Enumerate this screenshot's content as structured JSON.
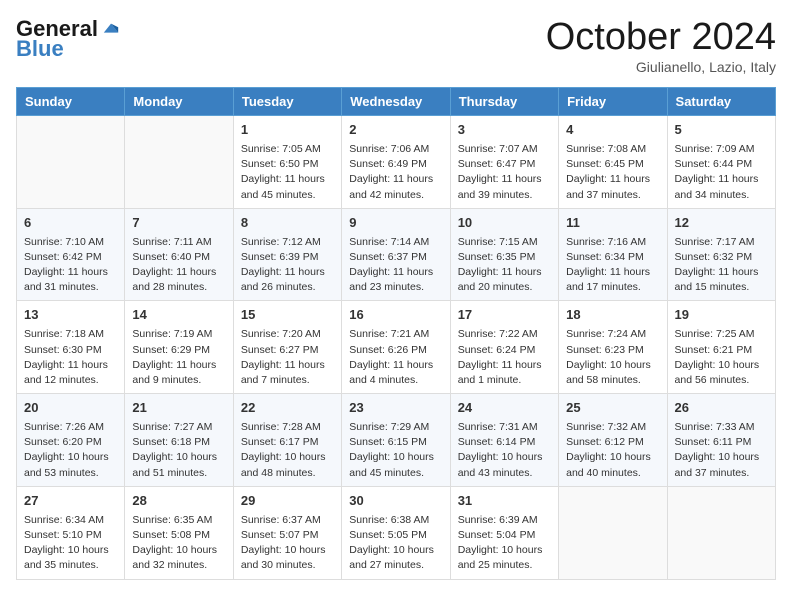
{
  "logo": {
    "general": "General",
    "blue": "Blue"
  },
  "title": {
    "month": "October 2024",
    "location": "Giulianello, Lazio, Italy"
  },
  "days": [
    "Sunday",
    "Monday",
    "Tuesday",
    "Wednesday",
    "Thursday",
    "Friday",
    "Saturday"
  ],
  "weeks": [
    [
      {
        "day": "",
        "sunrise": "",
        "sunset": "",
        "daylight": ""
      },
      {
        "day": "",
        "sunrise": "",
        "sunset": "",
        "daylight": ""
      },
      {
        "day": "1",
        "sunrise": "Sunrise: 7:05 AM",
        "sunset": "Sunset: 6:50 PM",
        "daylight": "Daylight: 11 hours and 45 minutes."
      },
      {
        "day": "2",
        "sunrise": "Sunrise: 7:06 AM",
        "sunset": "Sunset: 6:49 PM",
        "daylight": "Daylight: 11 hours and 42 minutes."
      },
      {
        "day": "3",
        "sunrise": "Sunrise: 7:07 AM",
        "sunset": "Sunset: 6:47 PM",
        "daylight": "Daylight: 11 hours and 39 minutes."
      },
      {
        "day": "4",
        "sunrise": "Sunrise: 7:08 AM",
        "sunset": "Sunset: 6:45 PM",
        "daylight": "Daylight: 11 hours and 37 minutes."
      },
      {
        "day": "5",
        "sunrise": "Sunrise: 7:09 AM",
        "sunset": "Sunset: 6:44 PM",
        "daylight": "Daylight: 11 hours and 34 minutes."
      }
    ],
    [
      {
        "day": "6",
        "sunrise": "Sunrise: 7:10 AM",
        "sunset": "Sunset: 6:42 PM",
        "daylight": "Daylight: 11 hours and 31 minutes."
      },
      {
        "day": "7",
        "sunrise": "Sunrise: 7:11 AM",
        "sunset": "Sunset: 6:40 PM",
        "daylight": "Daylight: 11 hours and 28 minutes."
      },
      {
        "day": "8",
        "sunrise": "Sunrise: 7:12 AM",
        "sunset": "Sunset: 6:39 PM",
        "daylight": "Daylight: 11 hours and 26 minutes."
      },
      {
        "day": "9",
        "sunrise": "Sunrise: 7:14 AM",
        "sunset": "Sunset: 6:37 PM",
        "daylight": "Daylight: 11 hours and 23 minutes."
      },
      {
        "day": "10",
        "sunrise": "Sunrise: 7:15 AM",
        "sunset": "Sunset: 6:35 PM",
        "daylight": "Daylight: 11 hours and 20 minutes."
      },
      {
        "day": "11",
        "sunrise": "Sunrise: 7:16 AM",
        "sunset": "Sunset: 6:34 PM",
        "daylight": "Daylight: 11 hours and 17 minutes."
      },
      {
        "day": "12",
        "sunrise": "Sunrise: 7:17 AM",
        "sunset": "Sunset: 6:32 PM",
        "daylight": "Daylight: 11 hours and 15 minutes."
      }
    ],
    [
      {
        "day": "13",
        "sunrise": "Sunrise: 7:18 AM",
        "sunset": "Sunset: 6:30 PM",
        "daylight": "Daylight: 11 hours and 12 minutes."
      },
      {
        "day": "14",
        "sunrise": "Sunrise: 7:19 AM",
        "sunset": "Sunset: 6:29 PM",
        "daylight": "Daylight: 11 hours and 9 minutes."
      },
      {
        "day": "15",
        "sunrise": "Sunrise: 7:20 AM",
        "sunset": "Sunset: 6:27 PM",
        "daylight": "Daylight: 11 hours and 7 minutes."
      },
      {
        "day": "16",
        "sunrise": "Sunrise: 7:21 AM",
        "sunset": "Sunset: 6:26 PM",
        "daylight": "Daylight: 11 hours and 4 minutes."
      },
      {
        "day": "17",
        "sunrise": "Sunrise: 7:22 AM",
        "sunset": "Sunset: 6:24 PM",
        "daylight": "Daylight: 11 hours and 1 minute."
      },
      {
        "day": "18",
        "sunrise": "Sunrise: 7:24 AM",
        "sunset": "Sunset: 6:23 PM",
        "daylight": "Daylight: 10 hours and 58 minutes."
      },
      {
        "day": "19",
        "sunrise": "Sunrise: 7:25 AM",
        "sunset": "Sunset: 6:21 PM",
        "daylight": "Daylight: 10 hours and 56 minutes."
      }
    ],
    [
      {
        "day": "20",
        "sunrise": "Sunrise: 7:26 AM",
        "sunset": "Sunset: 6:20 PM",
        "daylight": "Daylight: 10 hours and 53 minutes."
      },
      {
        "day": "21",
        "sunrise": "Sunrise: 7:27 AM",
        "sunset": "Sunset: 6:18 PM",
        "daylight": "Daylight: 10 hours and 51 minutes."
      },
      {
        "day": "22",
        "sunrise": "Sunrise: 7:28 AM",
        "sunset": "Sunset: 6:17 PM",
        "daylight": "Daylight: 10 hours and 48 minutes."
      },
      {
        "day": "23",
        "sunrise": "Sunrise: 7:29 AM",
        "sunset": "Sunset: 6:15 PM",
        "daylight": "Daylight: 10 hours and 45 minutes."
      },
      {
        "day": "24",
        "sunrise": "Sunrise: 7:31 AM",
        "sunset": "Sunset: 6:14 PM",
        "daylight": "Daylight: 10 hours and 43 minutes."
      },
      {
        "day": "25",
        "sunrise": "Sunrise: 7:32 AM",
        "sunset": "Sunset: 6:12 PM",
        "daylight": "Daylight: 10 hours and 40 minutes."
      },
      {
        "day": "26",
        "sunrise": "Sunrise: 7:33 AM",
        "sunset": "Sunset: 6:11 PM",
        "daylight": "Daylight: 10 hours and 37 minutes."
      }
    ],
    [
      {
        "day": "27",
        "sunrise": "Sunrise: 6:34 AM",
        "sunset": "Sunset: 5:10 PM",
        "daylight": "Daylight: 10 hours and 35 minutes."
      },
      {
        "day": "28",
        "sunrise": "Sunrise: 6:35 AM",
        "sunset": "Sunset: 5:08 PM",
        "daylight": "Daylight: 10 hours and 32 minutes."
      },
      {
        "day": "29",
        "sunrise": "Sunrise: 6:37 AM",
        "sunset": "Sunset: 5:07 PM",
        "daylight": "Daylight: 10 hours and 30 minutes."
      },
      {
        "day": "30",
        "sunrise": "Sunrise: 6:38 AM",
        "sunset": "Sunset: 5:05 PM",
        "daylight": "Daylight: 10 hours and 27 minutes."
      },
      {
        "day": "31",
        "sunrise": "Sunrise: 6:39 AM",
        "sunset": "Sunset: 5:04 PM",
        "daylight": "Daylight: 10 hours and 25 minutes."
      },
      {
        "day": "",
        "sunrise": "",
        "sunset": "",
        "daylight": ""
      },
      {
        "day": "",
        "sunrise": "",
        "sunset": "",
        "daylight": ""
      }
    ]
  ]
}
